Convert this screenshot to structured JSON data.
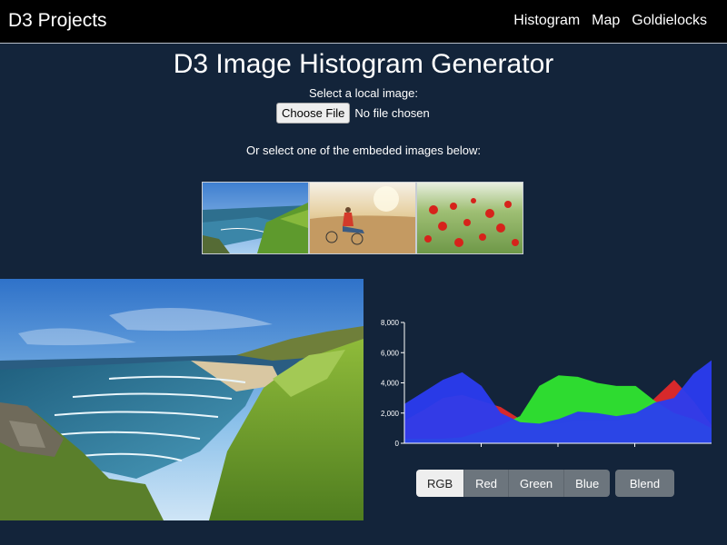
{
  "navbar": {
    "brand": "D3 Projects",
    "links": [
      "Histogram",
      "Map",
      "Goldielocks"
    ]
  },
  "header": {
    "title": "D3 Image Histogram Generator",
    "local_label": "Select a local image:",
    "file_button": "Choose File",
    "file_status": "No file chosen",
    "embed_label": "Or select one of the embeded images below:"
  },
  "thumbnails": [
    {
      "name": "coastline"
    },
    {
      "name": "person-in-field"
    },
    {
      "name": "poppies"
    }
  ],
  "histogram": {
    "channels": [
      "RGB",
      "Red",
      "Green",
      "Blue"
    ],
    "active_channel": "RGB",
    "blend_label": "Blend",
    "colors": {
      "red": "#e12a2a",
      "green": "#2fe62f",
      "blue": "#2a3cf0"
    }
  },
  "chart_data": {
    "type": "area",
    "title": "",
    "xlabel": "",
    "ylabel": "",
    "ylim": [
      0,
      8000
    ],
    "yticks": [
      "0",
      "2,000",
      "4,000",
      "6,000",
      "8,000"
    ],
    "x": [
      0,
      16,
      32,
      48,
      64,
      80,
      96,
      112,
      128,
      144,
      160,
      176,
      192,
      208,
      224,
      240,
      255
    ],
    "series": [
      {
        "name": "",
        "color": "red",
        "values": [
          1500,
          2200,
          3000,
          3200,
          2800,
          2400,
          1600,
          1200,
          1300,
          1500,
          1500,
          1500,
          1800,
          3000,
          4200,
          2800,
          1200
        ]
      },
      {
        "name": "",
        "color": "green",
        "values": [
          300,
          300,
          300,
          400,
          800,
          1200,
          1800,
          3800,
          4500,
          4400,
          4000,
          3800,
          3800,
          2800,
          2000,
          1600,
          1000
        ]
      },
      {
        "name": "",
        "color": "blue",
        "values": [
          2600,
          3400,
          4200,
          4700,
          3800,
          2000,
          1400,
          1300,
          1600,
          2100,
          2000,
          1800,
          2000,
          2700,
          3000,
          4600,
          5500
        ]
      }
    ]
  }
}
